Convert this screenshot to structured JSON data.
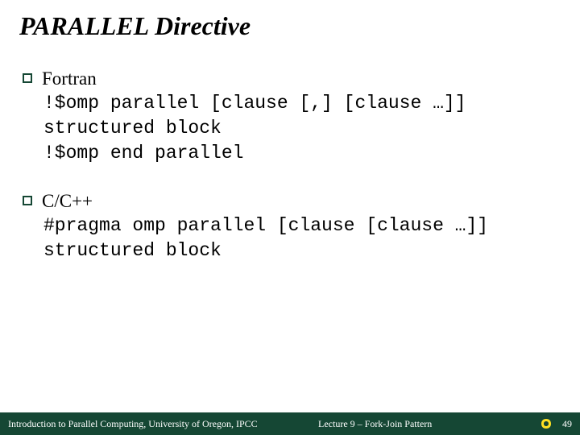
{
  "title": "PARALLEL Directive",
  "sections": [
    {
      "heading": "Fortran",
      "lines": [
        "!$omp parallel [clause [,] [clause …]]",
        "structured block",
        "!$omp end parallel"
      ]
    },
    {
      "heading": "C/C++",
      "lines": [
        "#pragma omp parallel [clause [clause …]]",
        "structured block"
      ]
    }
  ],
  "footer": {
    "left": "Introduction to Parallel Computing, University of Oregon, IPCC",
    "center": "Lecture 9 – Fork-Join Pattern",
    "page": "49"
  },
  "logo_name": "oregon-o-logo"
}
